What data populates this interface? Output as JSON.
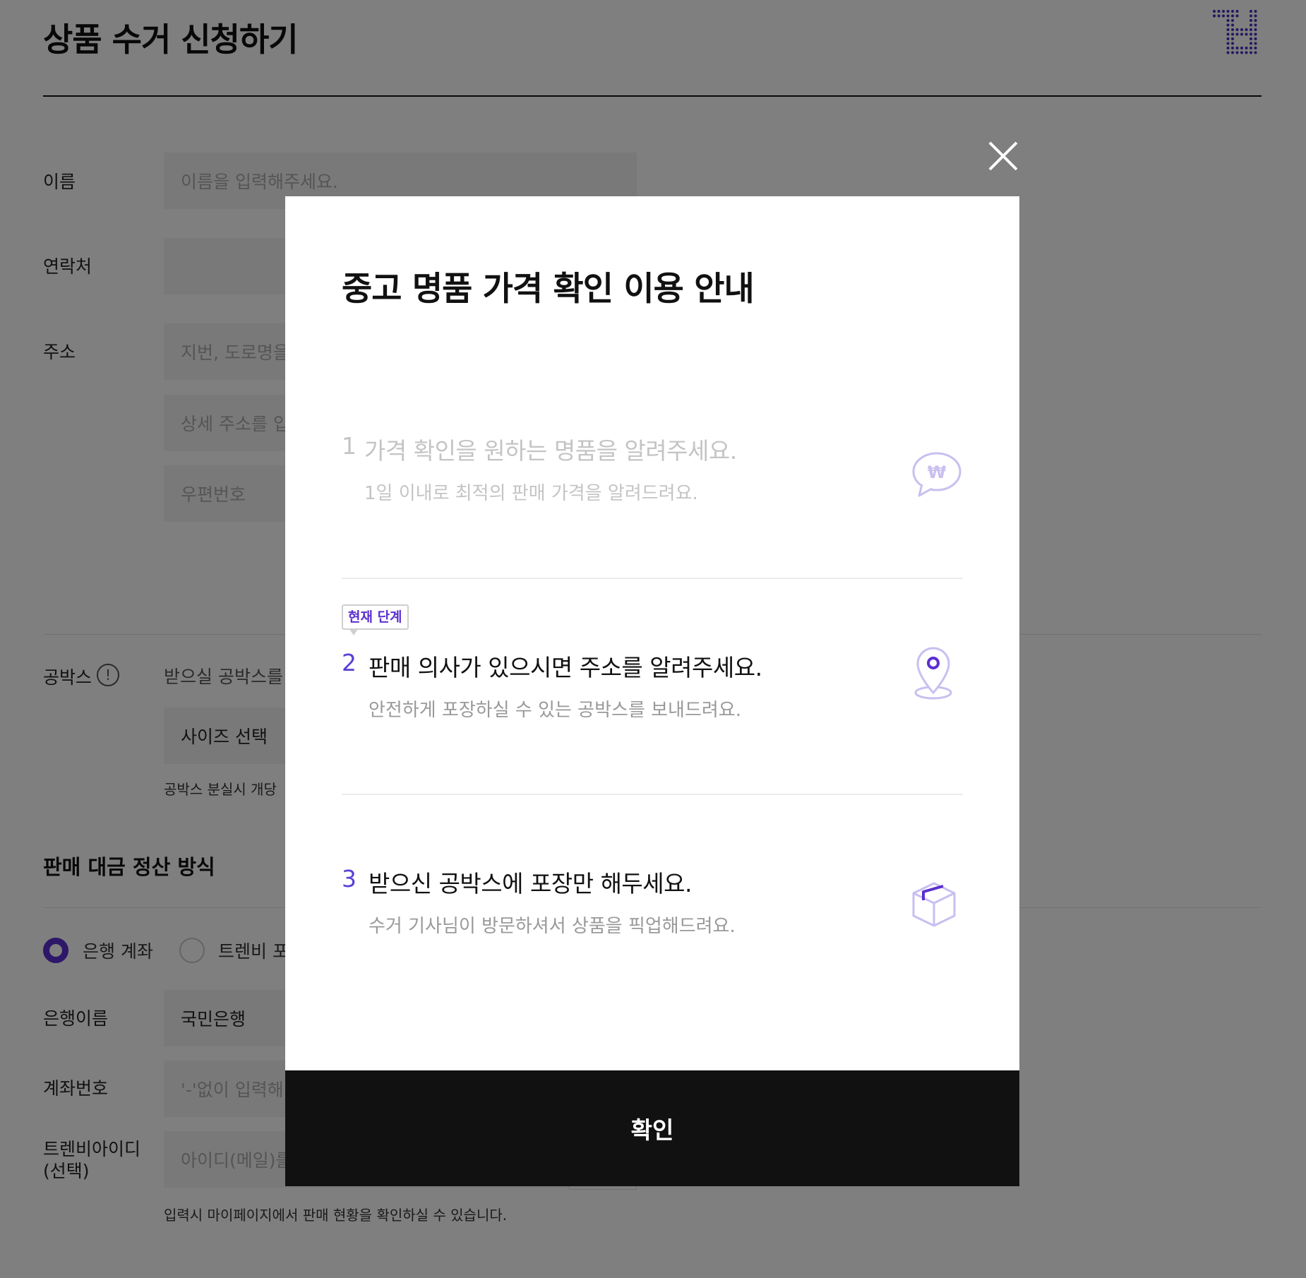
{
  "page": {
    "title": "상품 수거 신청하기",
    "form": {
      "name_label": "이름",
      "name_placeholder": "이름을 입력해주세요.",
      "contact_label": "연락처",
      "address_label": "주소",
      "address_placeholder": "지번, 도로명을",
      "address_detail_placeholder": "상세 주소를 입",
      "zipcode_placeholder": "우편번호",
      "box_label": "공박스",
      "box_info_icon": "!",
      "box_desc": "받으실 공박스를",
      "box_size_value": "사이즈 선택",
      "box_note": "공박스 분실시 개당",
      "settlement_heading": "판매 대금 정산 방식",
      "radio_bank_label": "은행 계좌",
      "radio_point_label": "트렌비 포",
      "bank_name_label": "은행이름",
      "bank_name_value": "국민은행",
      "account_label": "계좌번호",
      "account_placeholder": "'-'없이 입력해",
      "trenbe_id_label_line1": "트렌비아이디",
      "trenbe_id_label_line2": "(선택)",
      "trenbe_id_placeholder": "아이디(메일)를",
      "trenbe_id_note": "입력시 마이페이지에서 판매 현황을 확인하실 수 있습니다."
    }
  },
  "modal": {
    "title": "중고 명품 가격 확인 이용 안내",
    "current_badge": "현재 단계",
    "steps": [
      {
        "num": "1",
        "title": "가격 확인을 원하는 명품을 알려주세요.",
        "sub": "1일 이내로 최적의 판매 가격을 알려드려요.",
        "icon": "speech-bubble-won-icon",
        "icon_glyph": "₩"
      },
      {
        "num": "2",
        "title": "판매 의사가 있으시면 주소를 알려주세요.",
        "sub": "안전하게 포장하실 수 있는 공박스를 보내드려요.",
        "icon": "location-pin-icon"
      },
      {
        "num": "3",
        "title": "받으신 공박스에 포장만 해두세요.",
        "sub": "수거 기사님이 방문하셔서 상품을 픽업해드려요.",
        "icon": "box-icon"
      }
    ],
    "confirm_label": "확인"
  },
  "colors": {
    "accent": "#5b2fd0",
    "icon_light": "#c9bff0",
    "overlay": "rgba(0,0,0,0.5)",
    "confirm_bg": "#111111"
  }
}
